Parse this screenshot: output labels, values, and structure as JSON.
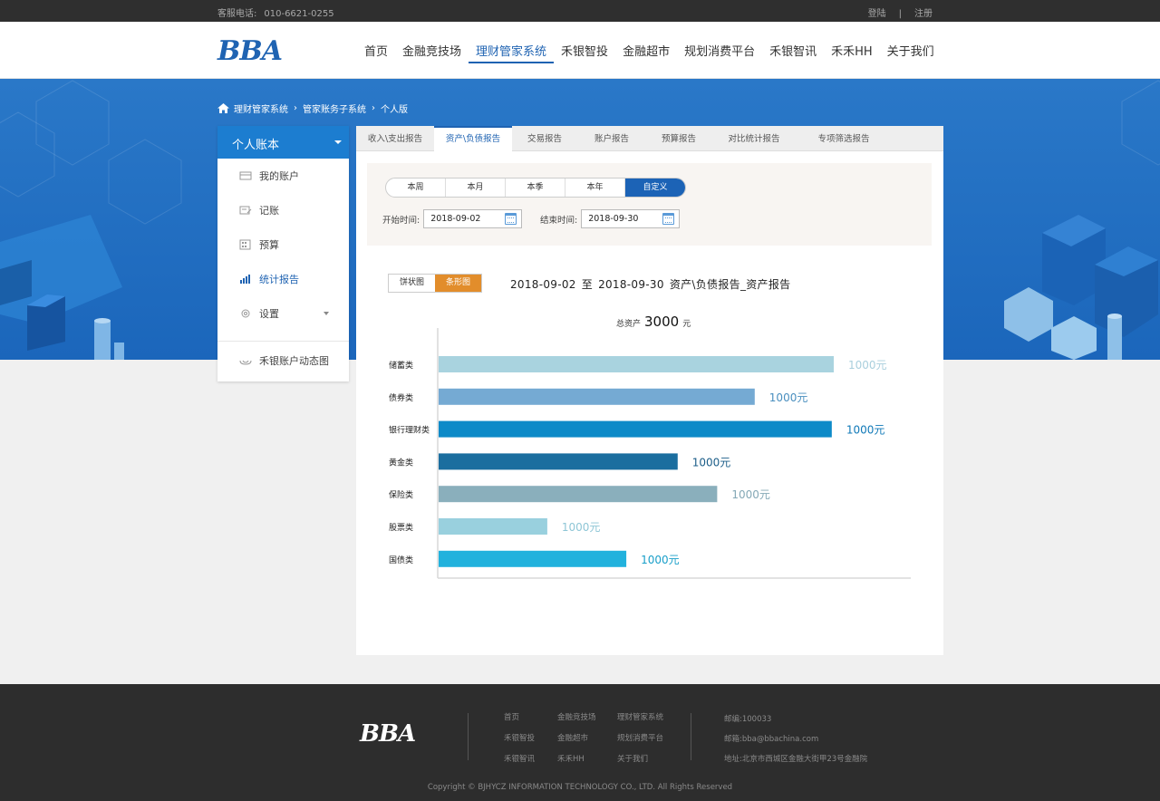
{
  "topbar": {
    "phone_label": "客服电话:",
    "phone": "010-6621-0255",
    "login": "登陆",
    "separator": "|",
    "register": "注册"
  },
  "header": {
    "logo": "BBA",
    "nav": [
      "首页",
      "金融竞技场",
      "理财管家系统",
      "禾银智投",
      "金融超市",
      "规划消费平台",
      "禾银智讯",
      "禾禾HH",
      "关于我们"
    ],
    "active_nav": "理财管家系统"
  },
  "breadcrumb": [
    "理财管家系统",
    "管家账务子系统",
    "个人版"
  ],
  "sidebar": {
    "title": "个人账本",
    "items": [
      {
        "label": "我的账户",
        "icon": "card-icon"
      },
      {
        "label": "记账",
        "icon": "note-icon"
      },
      {
        "label": "预算",
        "icon": "calculator-icon"
      },
      {
        "label": "统计报告",
        "icon": "bar-chart-icon"
      },
      {
        "label": "设置",
        "icon": "gear-icon"
      }
    ],
    "active": "统计报告",
    "bottom_item": {
      "label": "禾银账户动态图",
      "icon": "cloud-icon"
    }
  },
  "tabs": [
    "收入\\支出报告",
    "资产\\负债报告",
    "交易报告",
    "账户报告",
    "预算报告",
    "对比统计报告",
    "专项筛选报告"
  ],
  "active_tab": "资产\\负债报告",
  "filter": {
    "periods": [
      "本周",
      "本月",
      "本季",
      "本年",
      "自定义"
    ],
    "active_period": "自定义",
    "start_label": "开始时间:",
    "start_value": "2018-09-02",
    "end_label": "结束时间:",
    "end_value": "2018-09-30"
  },
  "view_toggle": {
    "pie": "饼状图",
    "bar": "条形图",
    "active": "条形图"
  },
  "report": {
    "from": "2018-09-02",
    "to_word": "至",
    "to": "2018-09-30",
    "name": "资产\\负债报告_资产报告"
  },
  "total": {
    "label": "总资产",
    "value": "3000",
    "unit": "元"
  },
  "chart_data": {
    "type": "bar",
    "orientation": "horizontal",
    "categories": [
      "储蓄类",
      "债券类",
      "银行理财类",
      "黄金类",
      "保险类",
      "股票类",
      "国债类"
    ],
    "value_labels": [
      "1000元",
      "1000元",
      "1000元",
      "1000元",
      "1000元",
      "1000元",
      "1000元"
    ],
    "relative_lengths": [
      1.0,
      0.8,
      0.995,
      0.605,
      0.705,
      0.275,
      0.475
    ],
    "colors": [
      "#a9d3df",
      "#75aad3",
      "#0d8ac8",
      "#1b6e9f",
      "#8aafbc",
      "#99d0de",
      "#22b2dd"
    ],
    "label_colors": [
      "#a9cfdd",
      "#4a8fbf",
      "#1079b8",
      "#1b5d88",
      "#84a8b6",
      "#8ec6d6",
      "#199fc9"
    ]
  },
  "footer": {
    "logo": "BBA",
    "links": [
      "首页",
      "金融竞技场",
      "理财管家系统",
      "禾银智投",
      "金融超市",
      "规划消费平台",
      "禾银智讯",
      "禾禾HH",
      "关于我们"
    ],
    "postcode": "邮编:100033",
    "email": "邮箱:bba@bbachina.com",
    "address": "地址:北京市西城区金融大街甲23号金融院",
    "copyright": "Copyright © BJHYCZ INFORMATION TECHNOLOGY CO., LTD. All Rights Reserved"
  }
}
